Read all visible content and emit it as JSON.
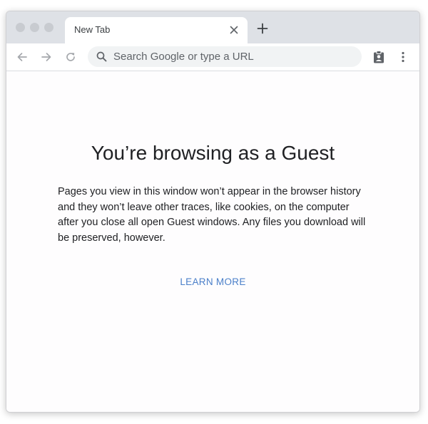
{
  "tab": {
    "title": "New Tab"
  },
  "omnibox": {
    "placeholder": "Search Google or type a URL"
  },
  "page": {
    "heading": "You’re browsing as a Guest",
    "description": "Pages you view in this window won’t appear in the browser history and they won’t leave other traces, like cookies, on the computer after you close all open Guest windows. Any files you download will be preserved, however.",
    "learn_more": "LEARN MORE"
  },
  "icons": {
    "close": "close-icon",
    "new_tab": "plus-icon",
    "back": "arrow-left-icon",
    "forward": "arrow-right-icon",
    "reload": "reload-icon",
    "search": "search-icon",
    "profile": "guest-profile-icon",
    "menu": "kebab-menu-icon"
  },
  "colors": {
    "accent": "#4a7fc9",
    "tabstrip": "#dee1e6"
  }
}
